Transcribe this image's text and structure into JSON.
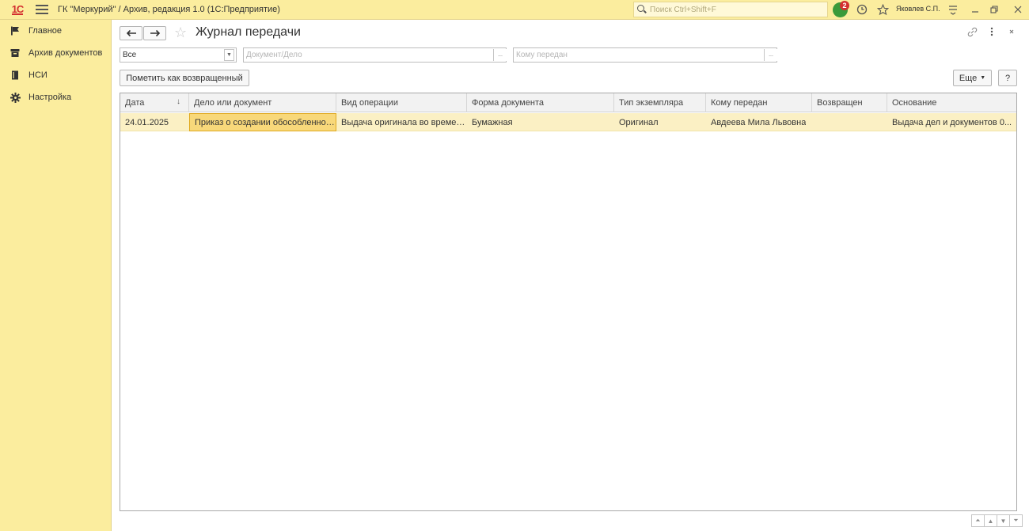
{
  "topbar": {
    "logo_text": "1С",
    "app_title": "ГК \"Меркурий\" / Архив, редакция 1.0  (1С:Предприятие)",
    "search_placeholder": "Поиск Ctrl+Shift+F",
    "notification_count": "2",
    "user_name": "Яковлев С.П."
  },
  "sidebar": {
    "items": [
      {
        "label": "Главное",
        "icon": "flag-icon"
      },
      {
        "label": "Архив документов",
        "icon": "archive-box-icon"
      },
      {
        "label": "НСИ",
        "icon": "reference-book-icon"
      },
      {
        "label": "Настройка",
        "icon": "gear-icon"
      }
    ]
  },
  "form": {
    "title": "Журнал передачи",
    "filter_type_value": "Все",
    "document_placeholder": "Документ/Дело",
    "recipient_placeholder": "Кому передан",
    "ellipsis": "...",
    "mark_returned_label": "Пометить как возвращенный",
    "more_label": "Еще",
    "help_label": "?"
  },
  "table": {
    "columns": [
      "Дата",
      "Дело или документ",
      "Вид операции",
      "Форма документа",
      "Тип экземпляра",
      "Кому передан",
      "Возвращен",
      "Основание"
    ],
    "rows": [
      [
        "24.01.2025",
        "Приказ о создании обособленного подразделения",
        "Выдача оригинала во временное пользование",
        "Бумажная",
        "Оригинал",
        "Авдеева Мила Львовна",
        "",
        "Выдача дел и документов 0..."
      ]
    ]
  },
  "colors": {
    "panel_yellow": "#fbed9e",
    "row_highlight": "#fbf0c4",
    "active_cell": "#f8d87a"
  }
}
